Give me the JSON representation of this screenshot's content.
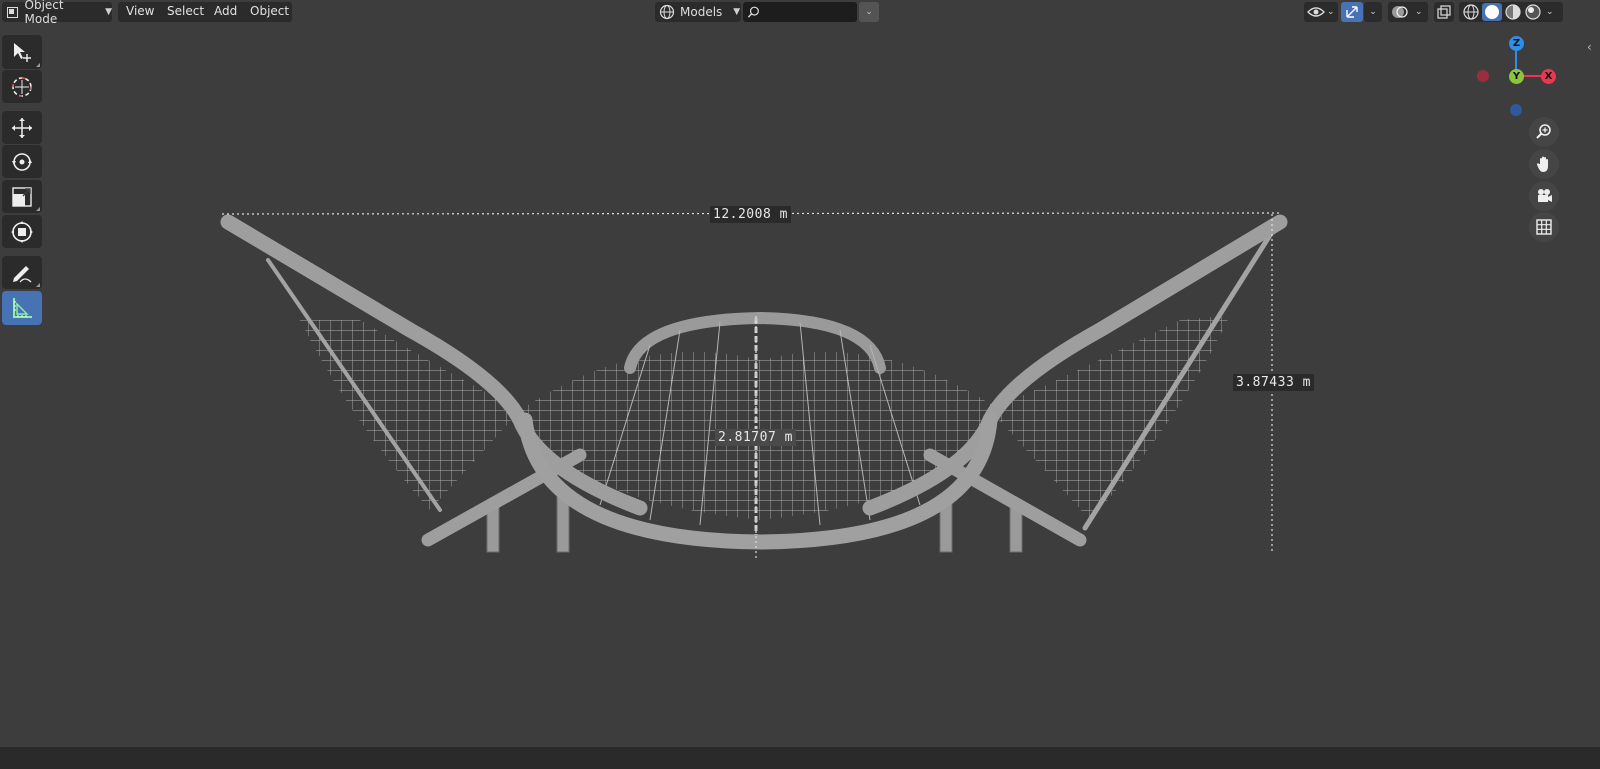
{
  "header": {
    "mode": {
      "label": "Object Mode",
      "icon": "object-mode-icon"
    },
    "menus": [
      "View",
      "Select",
      "Add",
      "Object"
    ],
    "asset_library": {
      "label": "Models",
      "icon": "globe-icon"
    },
    "search": {
      "placeholder": "",
      "value": ""
    }
  },
  "toolbar": {
    "tools": [
      {
        "name": "select-box-tool",
        "icon": "select-cursor-icon",
        "active": false
      },
      {
        "name": "cursor-tool",
        "icon": "3d-cursor-icon",
        "active": false
      },
      {
        "name": "move-tool",
        "icon": "move-arrows-icon",
        "active": false
      },
      {
        "name": "rotate-tool",
        "icon": "rotate-icon",
        "active": false
      },
      {
        "name": "scale-tool",
        "icon": "scale-icon",
        "active": false
      },
      {
        "name": "transform-tool",
        "icon": "transform-icon",
        "active": false
      },
      {
        "name": "annotate-tool",
        "icon": "pencil-icon",
        "active": false
      },
      {
        "name": "measure-tool",
        "icon": "ruler-icon",
        "active": true
      }
    ]
  },
  "gizmo": {
    "z": "Z",
    "y": "Y",
    "x": "X"
  },
  "navigation": [
    "zoom-icon",
    "hand-pan-icon",
    "camera-icon",
    "grid-icon"
  ],
  "measurements": {
    "width": "12.2008 m",
    "height": "3.87433 m",
    "depth": "2.81707 m"
  },
  "colors": {
    "viewport_bg": "#3d3d3d",
    "active_tool": "#4772b3",
    "axis_x": "#e8384f",
    "axis_y": "#8cc63f",
    "axis_z": "#2f8fe8"
  }
}
